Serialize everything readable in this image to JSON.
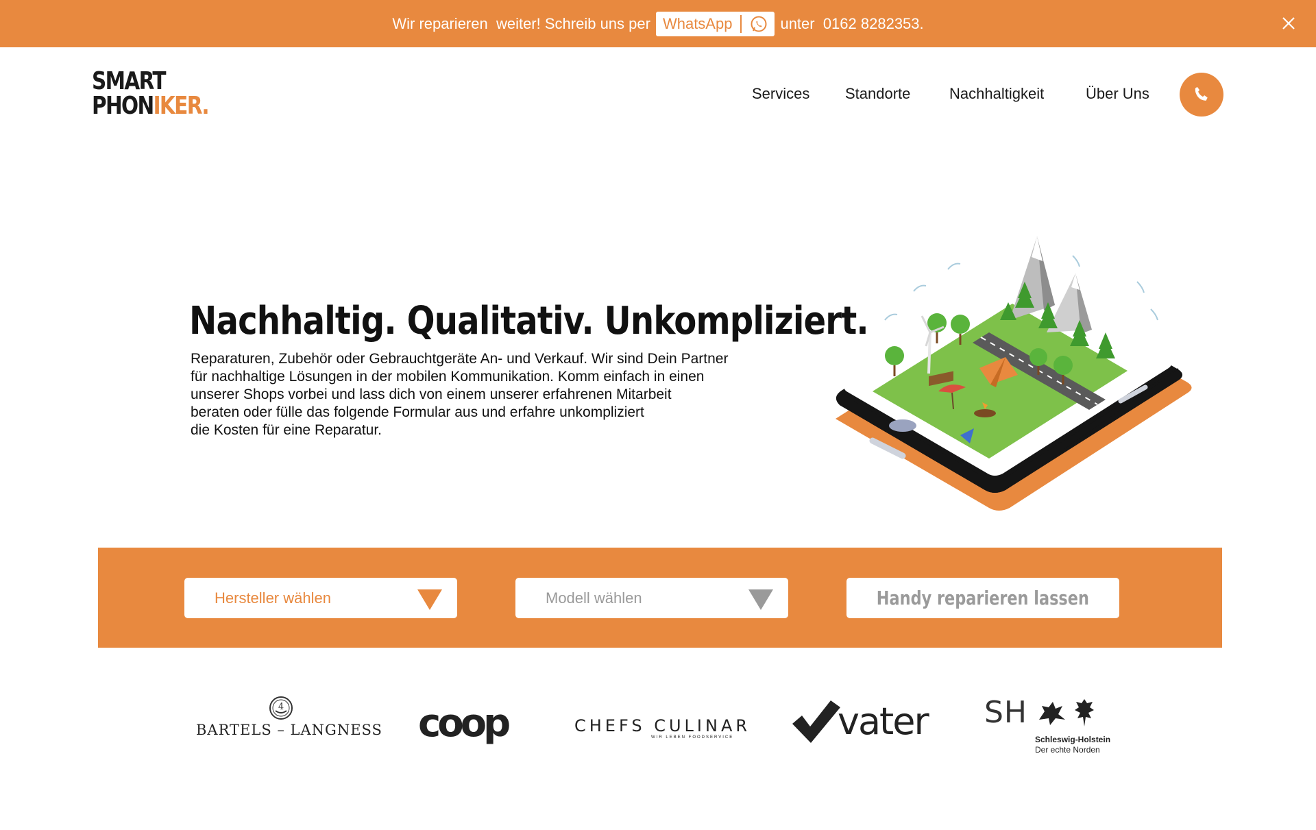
{
  "banner": {
    "text_before": "Wir reparieren  weiter! Schreib uns per",
    "whatsapp_label": "WhatsApp",
    "text_after": "unter  0162 8282353.",
    "color": "#e8893f"
  },
  "logo": {
    "line1": "SMART",
    "line2_dark": "PHON",
    "line2_accent": "IKER."
  },
  "nav": {
    "items": [
      "Services",
      "Standorte",
      "Nachhaltigkeit",
      "Über Uns"
    ]
  },
  "hero": {
    "title": "Nachhaltig. Qualitativ. Unkompliziert.",
    "text_lines": [
      "Reparaturen, Zubehör oder Gebrauchtgeräte An- und Verkauf. Wir sind Dein Partner",
      "für nachhaltige Lösungen in der mobilen Kommunikation. Komm einfach in einen",
      "unserer Shops vorbei und lass dich von einem unserer erfahrenen Mitarbeit",
      "beraten oder fülle das folgende Formular aus und erfahre unkompliziert",
      "die Kosten für eine Reparatur."
    ]
  },
  "form": {
    "manufacturer_placeholder": "Hersteller wählen",
    "model_placeholder": "Modell wählen",
    "submit_label": "Handy reparieren lassen"
  },
  "partners": {
    "bartels": "BARTELS – LANGNESS",
    "coop": "coop",
    "chefs": "CHEFS CULINAR",
    "chefs_sub": "WIR LEBEN FOODSERVICE",
    "vater": "vater",
    "sh": "SH",
    "sh_name": "Schleswig-Holstein",
    "sh_claim": "Der echte Norden"
  },
  "colors": {
    "accent": "#e8893f",
    "dark": "#1a1a1a",
    "grey": "#9a9a9a"
  }
}
